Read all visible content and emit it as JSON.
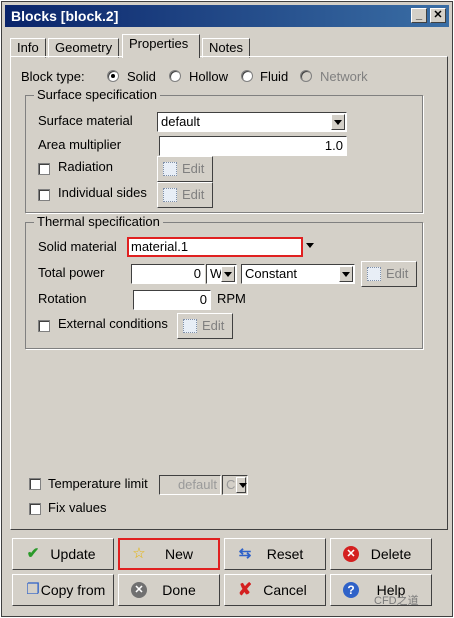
{
  "window": {
    "title": "Blocks [block.2]",
    "minimize": "_",
    "close": "✕"
  },
  "tabs": [
    "Info",
    "Geometry",
    "Properties",
    "Notes"
  ],
  "block_type": {
    "label": "Block type:",
    "options": [
      "Solid",
      "Hollow",
      "Fluid",
      "Network"
    ],
    "selected": "Solid"
  },
  "surface": {
    "title": "Surface specification",
    "material_label": "Surface material",
    "material_value": "default",
    "area_label": "Area multiplier",
    "area_value": "1.0",
    "radiation_label": "Radiation",
    "sides_label": "Individual sides",
    "edit": "Edit"
  },
  "thermal": {
    "title": "Thermal specification",
    "material_label": "Solid material",
    "material_value": "material.1",
    "power_label": "Total power",
    "power_value": "0",
    "power_unit": "W",
    "power_mode": "Constant",
    "rotation_label": "Rotation",
    "rotation_value": "0",
    "rotation_unit": "RPM",
    "external_label": "External conditions",
    "edit": "Edit"
  },
  "temp_limit": {
    "label": "Temperature limit",
    "value": "default",
    "unit": "C"
  },
  "fix_values": {
    "label": "Fix values"
  },
  "buttons": {
    "update": "Update",
    "new": "New",
    "reset": "Reset",
    "delete": "Delete",
    "copy_from": "Copy from",
    "done": "Done",
    "cancel": "Cancel",
    "help": "Help"
  },
  "watermark": "CFD之道"
}
